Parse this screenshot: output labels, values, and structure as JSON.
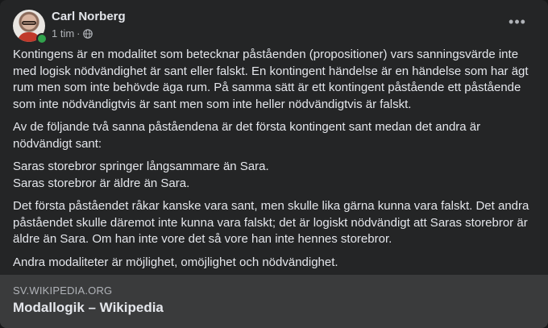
{
  "post": {
    "author": "Carl Norberg",
    "time": "1 tim",
    "separator": "·",
    "paragraphs": [
      "Kontingens är en modalitet som betecknar påståenden (propositioner) vars sanningsvärde inte med logisk nödvändighet är sant eller falskt. En kontingent händelse är en händelse som har ägt rum men som inte behövde äga rum. På samma sätt är ett kontingent påstående ett påstående som inte nödvändigtvis är sant men som inte heller nödvändigtvis är falskt.",
      "Av de följande två sanna påståendena är det första kontingent sant medan det andra är nödvändigt sant:",
      "Det första påståendet råkar kanske vara sant, men skulle lika gärna kunna vara falskt. Det andra påståendet skulle däremot inte kunna vara falskt; det är logiskt nödvändigt att Saras storebror är äldre än Sara. Om han inte vore det så vore han inte hennes storebror.",
      "Andra modaliteter är möjlighet, omöjlighet och nödvändighet."
    ],
    "examples": [
      "Saras storebror springer långsammare än Sara.",
      "Saras storebror är äldre än Sara."
    ]
  },
  "link": {
    "domain": "SV.WIKIPEDIA.ORG",
    "title": "Modallogik – Wikipedia"
  },
  "icons": {
    "more": "more-options-icon",
    "privacy": "globe-icon"
  },
  "colors": {
    "card": "#242526",
    "text": "#e4e6eb",
    "secondary": "#b0b3b8",
    "online": "#31a24c",
    "preview": "#3a3b3c"
  }
}
